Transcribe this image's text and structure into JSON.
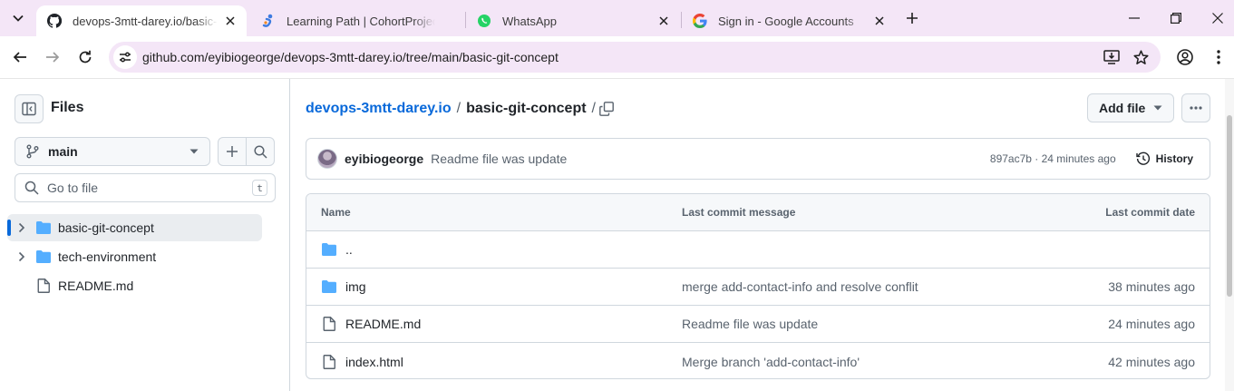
{
  "browser": {
    "tabs": [
      {
        "title": "devops-3mtt-darey.io/basic-git-concept",
        "favicon": "github-icon",
        "active": true
      },
      {
        "title": "Learning Path | CohortProject | Darey",
        "favicon": "darey-icon",
        "active": false
      },
      {
        "title": "WhatsApp",
        "favicon": "whatsapp-icon",
        "active": false
      },
      {
        "title": "Sign in - Google Accounts",
        "favicon": "google-icon",
        "active": false
      }
    ],
    "url": "github.com/eyibiogeorge/devops-3mtt-darey.io/tree/main/basic-git-concept"
  },
  "sidebar": {
    "title": "Files",
    "branch": "main",
    "goto_placeholder": "Go to file",
    "goto_shortcut": "t",
    "tree": [
      {
        "name": "basic-git-concept",
        "type": "folder",
        "selected": true
      },
      {
        "name": "tech-environment",
        "type": "folder",
        "selected": false
      },
      {
        "name": "README.md",
        "type": "file",
        "selected": false
      }
    ]
  },
  "main": {
    "breadcrumb": {
      "repo": "devops-3mtt-darey.io",
      "sep1": "/",
      "current": "basic-git-concept",
      "sep2": "/"
    },
    "add_file_label": "Add file",
    "commit": {
      "author": "eyibiogeorge",
      "message": "Readme file was update",
      "meta": "897ac7b · 24 minutes ago",
      "history_label": "History"
    },
    "table": {
      "headers": {
        "name": "Name",
        "message": "Last commit message",
        "date": "Last commit date"
      },
      "rows": [
        {
          "name": "..",
          "type": "folder",
          "message": "",
          "date": ""
        },
        {
          "name": "img",
          "type": "folder",
          "message": "merge add-contact-info and resolve conflit",
          "date": "38 minutes ago"
        },
        {
          "name": "README.md",
          "type": "file",
          "message": "Readme file was update",
          "date": "24 minutes ago"
        },
        {
          "name": "index.html",
          "type": "file",
          "message": "Merge branch 'add-contact-info'",
          "date": "42 minutes ago"
        }
      ]
    }
  },
  "colors": {
    "link": "#0969da",
    "folder": "#54aeff",
    "tabstrip": "#f4e6f7",
    "border": "#d0d7de"
  }
}
